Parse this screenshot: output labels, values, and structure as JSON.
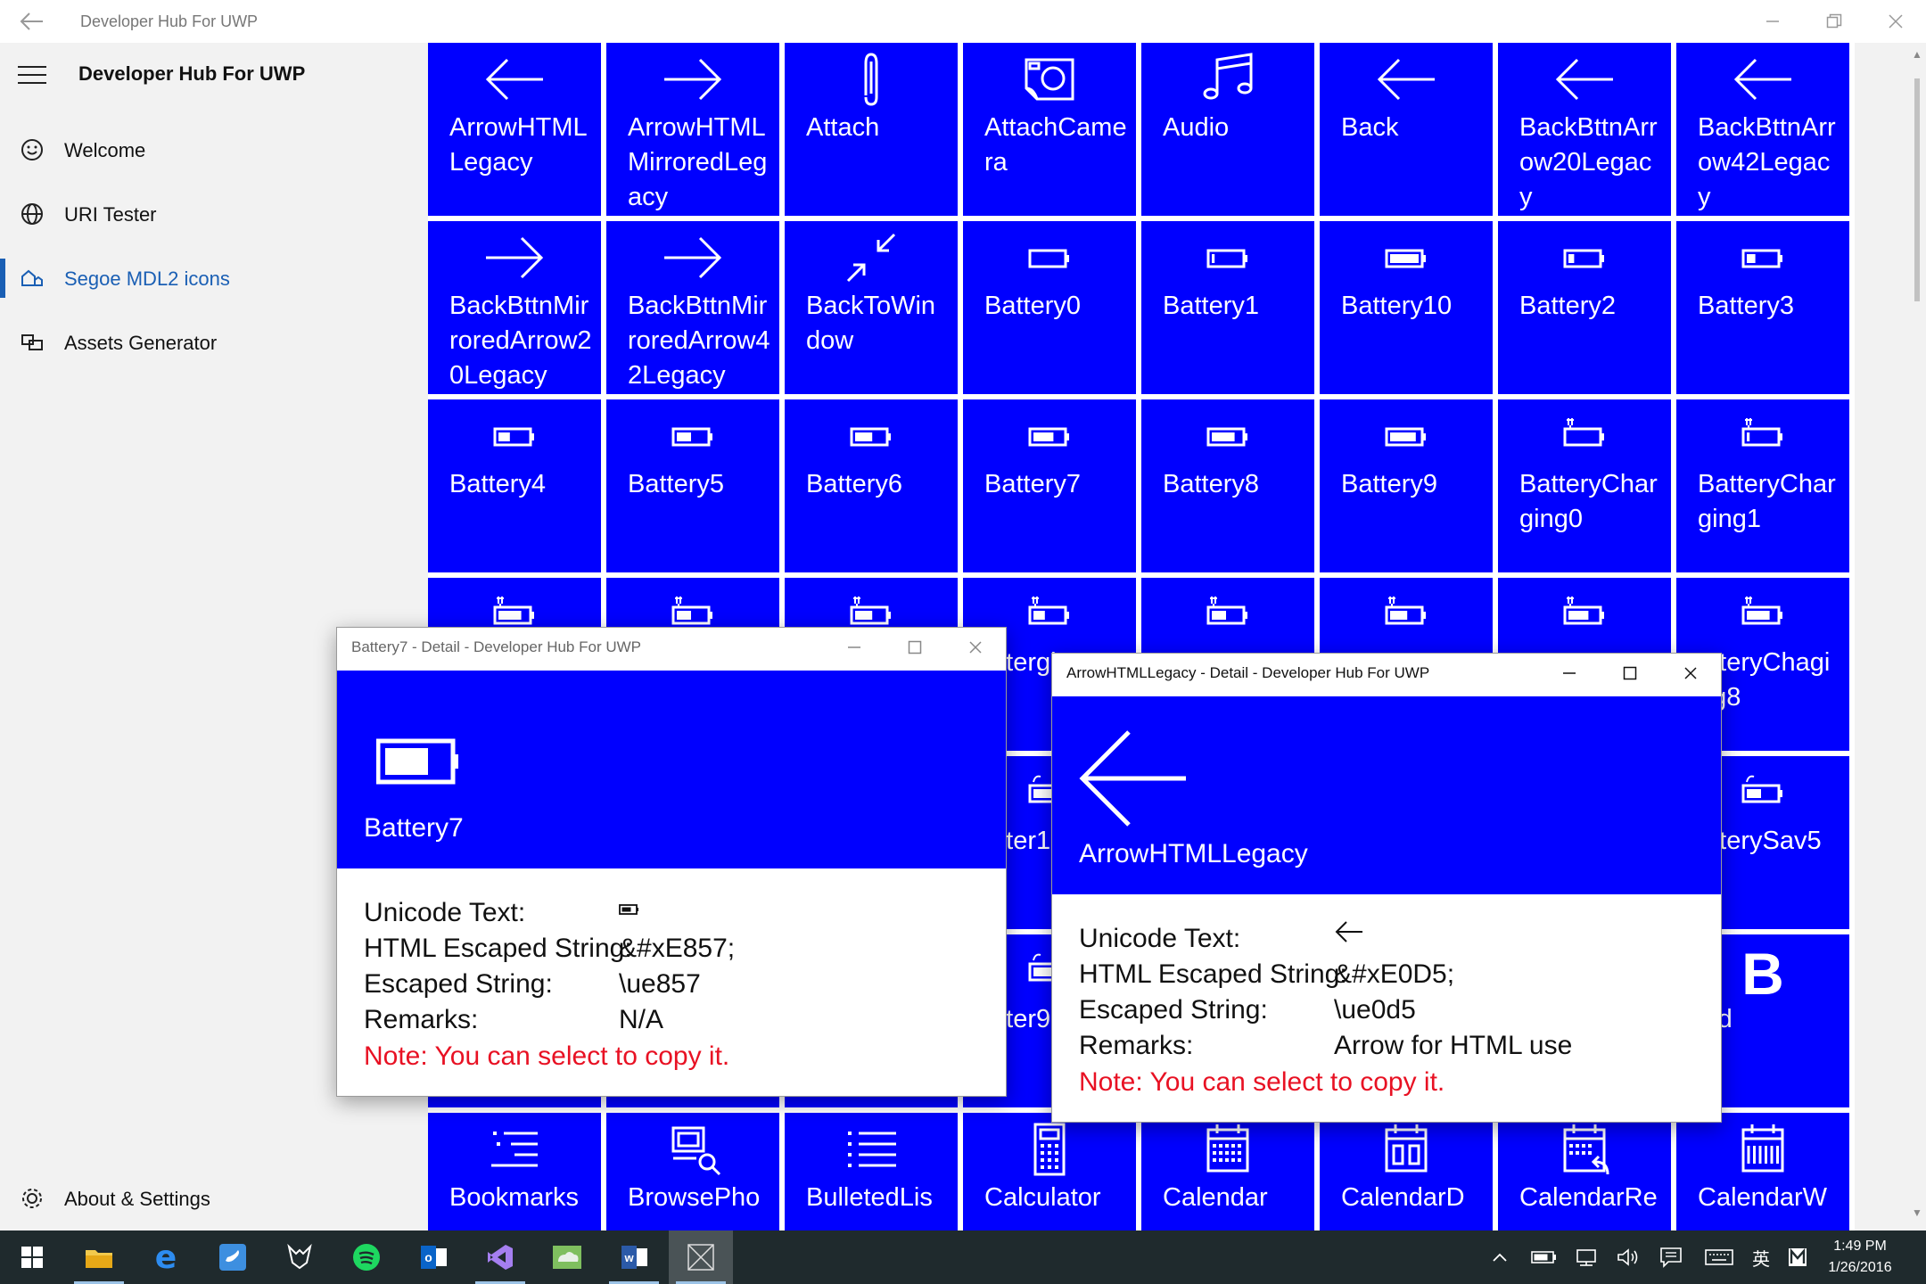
{
  "window": {
    "title": "Developer Hub For UWP"
  },
  "nav": {
    "app_title": "Developer Hub For UWP",
    "items": [
      {
        "label": "Welcome",
        "icon": "smiley-icon"
      },
      {
        "label": "URI Tester",
        "icon": "globe-icon"
      },
      {
        "label": "Segoe MDL2 icons",
        "icon": "icons-icon",
        "selected": true
      },
      {
        "label": "Assets Generator",
        "icon": "assets-icon"
      }
    ],
    "footer": {
      "label": "About & Settings",
      "icon": "gear-icon"
    }
  },
  "tiles": [
    {
      "name": "ArrowHTMLLegacy",
      "icon": "arrow-left"
    },
    {
      "name": "ArrowHTMLMirroredLegacy",
      "icon": "arrow-right"
    },
    {
      "name": "Attach",
      "icon": "paperclip"
    },
    {
      "name": "AttachCamera",
      "icon": "camera"
    },
    {
      "name": "Audio",
      "icon": "music"
    },
    {
      "name": "Back",
      "icon": "arrow-left"
    },
    {
      "name": "BackBttnArrow20Legacy",
      "icon": "arrow-left"
    },
    {
      "name": "BackBttnArrow42Legacy",
      "icon": "arrow-left"
    },
    {
      "name": "BackBttnMirroredArrow20Legacy",
      "icon": "arrow-right"
    },
    {
      "name": "BackBttnMirroredArrow42Legacy",
      "icon": "arrow-right"
    },
    {
      "name": "BackToWindow",
      "icon": "back-to-window"
    },
    {
      "name": "Battery0",
      "icon": "battery",
      "level": 0
    },
    {
      "name": "Battery1",
      "icon": "battery",
      "level": 0.1
    },
    {
      "name": "Battery10",
      "icon": "battery",
      "level": 1
    },
    {
      "name": "Battery2",
      "icon": "battery",
      "level": 0.2
    },
    {
      "name": "Battery3",
      "icon": "battery",
      "level": 0.3
    },
    {
      "name": "Battery4",
      "icon": "battery",
      "level": 0.4
    },
    {
      "name": "Battery5",
      "icon": "battery",
      "level": 0.5
    },
    {
      "name": "Battery6",
      "icon": "battery",
      "level": 0.6
    },
    {
      "name": "Battery7",
      "icon": "battery",
      "level": 0.7
    },
    {
      "name": "Battery8",
      "icon": "battery",
      "level": 0.8
    },
    {
      "name": "Battery9",
      "icon": "battery",
      "level": 0.9
    },
    {
      "name": "BatteryCharging0",
      "icon": "battery-charging",
      "level": 0
    },
    {
      "name": "BatteryCharging1",
      "icon": "battery-charging",
      "level": 0.1
    },
    {
      "name": "",
      "icon": "battery-charging",
      "level": 0.8
    },
    {
      "name": "",
      "icon": "battery-charging",
      "level": 0.5
    },
    {
      "name": "",
      "icon": "battery-charging",
      "level": 0.6
    },
    {
      "name": "atter​ging4",
      "icon": "battery-charging",
      "level": 0.4
    },
    {
      "name": "",
      "icon": "battery-charging",
      "level": 0.5
    },
    {
      "name": "",
      "icon": "battery-charging",
      "level": 0.6
    },
    {
      "name": "",
      "icon": "battery-charging",
      "level": 0.7
    },
    {
      "name": "atteryCha​ging8",
      "icon": "battery-charging",
      "level": 0.8
    },
    {
      "name": "",
      "icon": "battery-saver",
      "level": 0
    },
    {
      "name": "",
      "icon": "battery-saver",
      "level": 0
    },
    {
      "name": "",
      "icon": "battery-saver",
      "level": 0
    },
    {
      "name": "atter​10",
      "icon": "battery-saver",
      "level": 1
    },
    {
      "name": "",
      "icon": "battery-saver",
      "level": 0
    },
    {
      "name": "",
      "icon": "battery-saver",
      "level": 0
    },
    {
      "name": "",
      "icon": "battery-saver",
      "level": 0
    },
    {
      "name": "atterySav​5",
      "icon": "battery-saver",
      "level": 0.5
    },
    {
      "name": "",
      "icon": "battery-saver",
      "level": 0
    },
    {
      "name": "",
      "icon": "battery-saver",
      "level": 0
    },
    {
      "name": "",
      "icon": "battery-saver",
      "level": 0
    },
    {
      "name": "atter​9",
      "icon": "battery-saver",
      "level": 0.9
    },
    {
      "name": "",
      "icon": "battery-saver",
      "level": 0
    },
    {
      "name": "",
      "icon": "battery-saver",
      "level": 0
    },
    {
      "name": "",
      "icon": "battery-saver",
      "level": 0
    },
    {
      "name": "old",
      "icon": "bold"
    },
    {
      "name": "Bookmarks",
      "icon": "bookmarks"
    },
    {
      "name": "BrowsePho",
      "icon": "browse-photos"
    },
    {
      "name": "BulletedLis",
      "icon": "bulleted-list"
    },
    {
      "name": "Calculator",
      "icon": "calculator"
    },
    {
      "name": "Calendar",
      "icon": "calendar"
    },
    {
      "name": "CalendarD",
      "icon": "calendar-day"
    },
    {
      "name": "CalendarRe",
      "icon": "calendar-reply"
    },
    {
      "name": "CalendarW",
      "icon": "calendar-week"
    }
  ],
  "detail_battery7": {
    "window_title": "Battery7 - Detail - Developer Hub For UWP",
    "icon_name": "Battery7",
    "icon": "battery",
    "level": 0.7,
    "rows": [
      {
        "key": "Unicode Text:",
        "value": ""
      },
      {
        "key": "HTML Escaped String:",
        "value": "&#xE857;"
      },
      {
        "key": "Escaped String:",
        "value": "\\ue857"
      },
      {
        "key": "Remarks:",
        "value": "N/A"
      }
    ],
    "note": "Note: You can select to copy it."
  },
  "detail_arrow": {
    "window_title": "ArrowHTMLLegacy - Detail - Developer Hub For UWP",
    "icon_name": "ArrowHTMLLegacy",
    "icon": "arrow-left",
    "rows": [
      {
        "key": "Unicode Text:",
        "value": ""
      },
      {
        "key": "HTML Escaped String:",
        "value": "&#xE0D5;"
      },
      {
        "key": "Escaped String:",
        "value": "\\ue0d5"
      },
      {
        "key": "Remarks:",
        "value": "Arrow for HTML use"
      }
    ],
    "note": "Note: You can select to copy it."
  },
  "taskbar": {
    "apps": [
      "start-icon",
      "file-explorer-icon",
      "edge-icon",
      "twitter-icon",
      "foxit-icon",
      "spotify-icon",
      "outlook-icon",
      "visual-studio-icon",
      "weather-icon",
      "word-icon",
      "app-icon"
    ],
    "ime": "英",
    "time": "1:49 PM",
    "date": "1/26/2016"
  },
  "colors": {
    "tile": "#0000ff",
    "accent": "#1a5fb4",
    "note": "#e81123",
    "taskbar": "#1f2a2d"
  }
}
